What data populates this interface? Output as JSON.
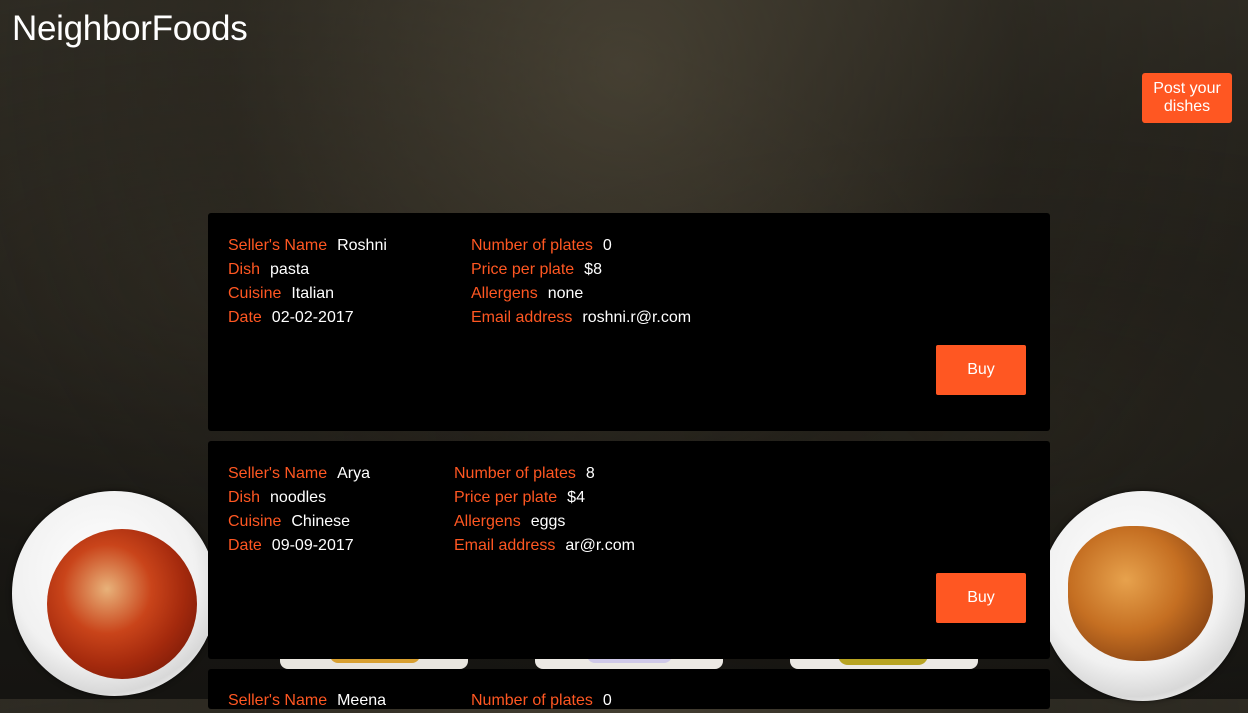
{
  "header": {
    "brand": "NeighborFoods",
    "post_button": "Post your dishes"
  },
  "labels": {
    "seller_name": "Seller's Name",
    "dish": "Dish",
    "cuisine": "Cuisine",
    "date": "Date",
    "plates": "Number of plates",
    "price": "Price per plate",
    "allergens": "Allergens",
    "email": "Email address"
  },
  "listings": [
    {
      "seller_name": "Roshni",
      "dish": "pasta",
      "cuisine": "Italian",
      "date": "02-02-2017",
      "plates": "0",
      "price": "$8",
      "allergens": "none",
      "email": "roshni.r@r.com",
      "buy_label": "Buy"
    },
    {
      "seller_name": "Arya",
      "dish": "noodles",
      "cuisine": "Chinese",
      "date": "09-09-2017",
      "plates": "8",
      "price": "$4",
      "allergens": "eggs",
      "email": "ar@r.com",
      "buy_label": "Buy"
    },
    {
      "seller_name": "Meena",
      "plates": "0"
    }
  ],
  "colors": {
    "accent": "#ff5722",
    "card_bg": "#000000",
    "text": "#ffffff"
  }
}
